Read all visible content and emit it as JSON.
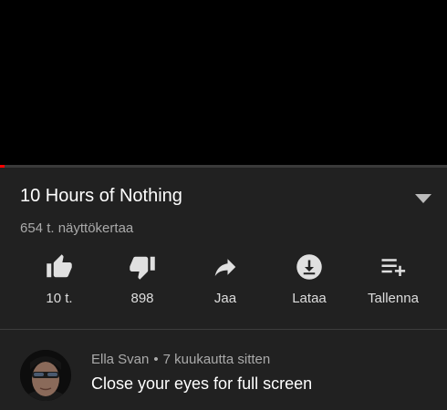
{
  "video": {
    "title": "10 Hours of Nothing",
    "views": "654 t. näyttökertaa",
    "progress": 0.01
  },
  "actions": [
    {
      "label": "10 t.",
      "icon": "thumbs-up-icon"
    },
    {
      "label": "898",
      "icon": "thumbs-down-icon"
    },
    {
      "label": "Jaa",
      "icon": "share-icon"
    },
    {
      "label": "Lataa",
      "icon": "download-icon"
    },
    {
      "label": "Tallenna",
      "icon": "playlist-add-icon"
    }
  ],
  "comment": {
    "author": "Ella Svan",
    "separator": "•",
    "time": "7 kuukautta sitten",
    "text": "Close your eyes for full screen"
  },
  "colors": {
    "background": "#212121",
    "player": "#000000",
    "progress": "#ff0000",
    "text": "#ffffff",
    "secondary_text": "#aaaaaa"
  }
}
